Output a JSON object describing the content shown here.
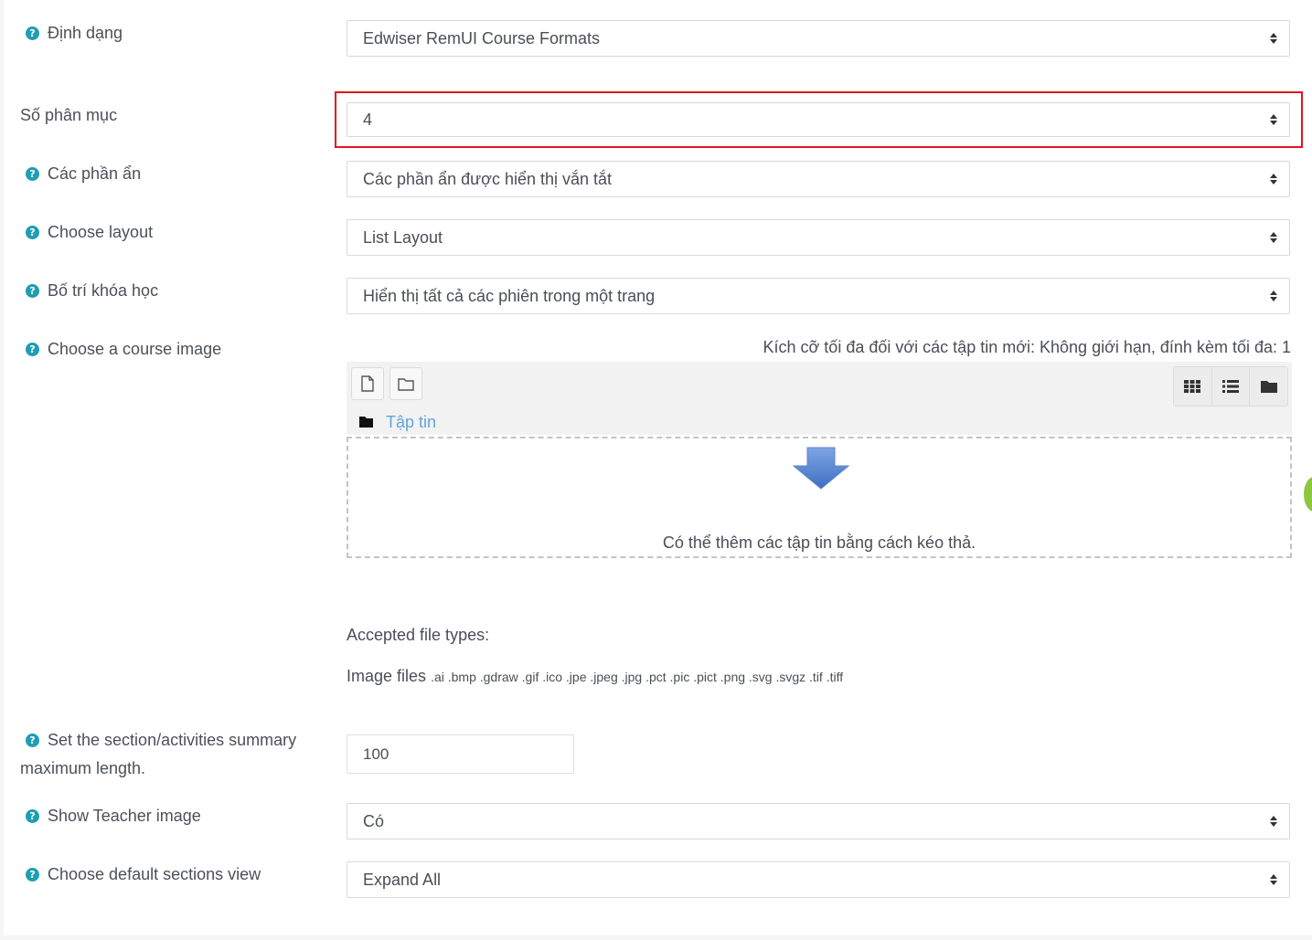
{
  "fields": [
    {
      "label": "Định dạng",
      "value": "Edwiser RemUI Course Formats"
    },
    {
      "label": "Số phân mục",
      "value": "4"
    },
    {
      "label": "Các phần ẩn",
      "value": "Các phần ẩn được hiển thị vắn tắt"
    },
    {
      "label": "Choose layout",
      "value": "List Layout"
    },
    {
      "label": "Bố trí khóa học",
      "value": "Hiển thị tất cả các phiên trong một trang"
    },
    {
      "label": "Choose a course image"
    },
    {
      "label_line1": "Set the section/activities summary",
      "label_line2": "maximum length.",
      "value": "100"
    },
    {
      "label": "Show Teacher image",
      "value": "Có"
    },
    {
      "label": "Choose default sections view",
      "value": "Expand All"
    }
  ],
  "filepicker": {
    "max_size_text": "Kích cỡ tối đa đối với các tập tin mới: Không giới hạn, đính kèm tối đa: 1",
    "path_label": "Tập tin",
    "drop_text": "Có thể thêm các tập tin bằng cách kéo thả.",
    "accepted_title": "Accepted file types:",
    "accepted_group": "Image files",
    "accepted_ext": ".ai .bmp .gdraw .gif .ico .jpe .jpeg .jpg .pct .pic .pict .png .svg .svgz .tif .tiff"
  },
  "help_glyph": "?",
  "colors": {
    "help_icon": "#1f9db3",
    "highlight": "#e3141f",
    "link": "#5ea6d9",
    "arrow": "#5b87d0"
  }
}
